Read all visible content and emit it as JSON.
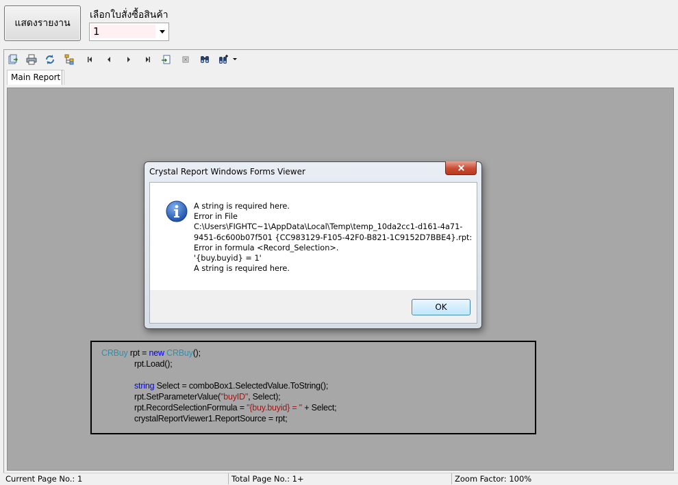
{
  "form": {
    "show_report_label": "แสดงรายงาน",
    "select_order_label": "เลือกใบสั่งซื้อสินค้า",
    "order_value": "1"
  },
  "viewer": {
    "tab_label": "Main Report",
    "toolbar_icons": [
      "export-icon",
      "print-icon",
      "refresh-icon",
      "group-tree-icon",
      "first-page-icon",
      "previous-page-icon",
      "next-page-icon",
      "last-page-icon",
      "goto-page-icon",
      "stop-icon",
      "search-icon",
      "zoom-icon"
    ],
    "status": {
      "current_page": "Current Page No.: 1",
      "total_page": "Total Page No.: 1+",
      "zoom": "Zoom Factor: 100%"
    }
  },
  "dialog": {
    "title": "Crystal Report Windows Forms Viewer",
    "message_lines": [
      "A string is required here.",
      "Error in File",
      "C:\\Users\\FIGHTC~1\\AppData\\Local\\Temp\\temp_10da2cc1-d161-4a71-",
      "9451-6c600b07f501 {CC983129-F105-42F0-B821-1C9152D7BBE4}.rpt:",
      "Error in formula  <Record_Selection>.",
      "'{buy.buyid} = 1'",
      "A string is required here."
    ],
    "ok_label": "OK",
    "icon": "info-icon"
  },
  "code": {
    "l1_type": "CRBuy",
    "l1_a": " rpt = ",
    "l1_new": "new",
    "l1_sp": " ",
    "l1_type2": "CRBuy",
    "l1_end": "();",
    "l2": "rpt.Load();",
    "l3_kw": "string",
    "l3_rest": " Select = comboBox1.SelectedValue.ToString();",
    "l4_a": "rpt.SetParameterValue(",
    "l4_str": "\"buyID\"",
    "l4_b": ", Select);",
    "l5_a": "rpt.RecordSelectionFormula = ",
    "l5_str": "\"{buy.buyid} = \"",
    "l5_b": " + Select;",
    "l6": "crystalReportViewer1.ReportSource = rpt;"
  }
}
